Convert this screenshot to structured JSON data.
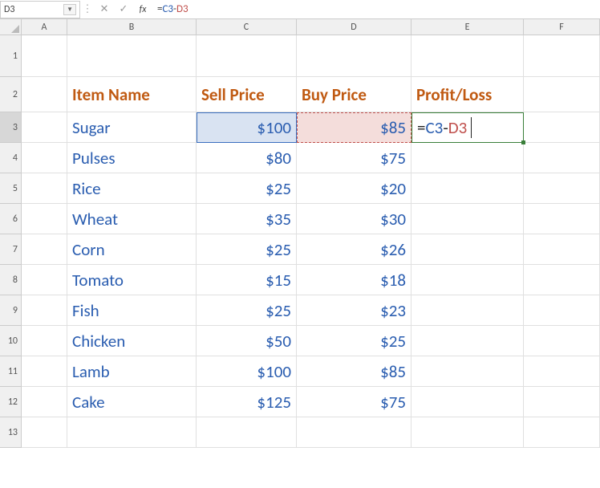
{
  "nameBox": {
    "value": "D3"
  },
  "formulaBar": {
    "cancel": "✕",
    "confirm": "✓",
    "fx": "fx",
    "prefix": "=",
    "ref1": "C3",
    "op": "-",
    "ref2": "D3"
  },
  "columns": [
    "A",
    "B",
    "C",
    "D",
    "E",
    "F"
  ],
  "rows": [
    "1",
    "2",
    "3",
    "4",
    "5",
    "6",
    "7",
    "8",
    "9",
    "10",
    "11",
    "12",
    "13"
  ],
  "headers": {
    "b": "Item Name",
    "c": "Sell Price",
    "d": "Buy Price",
    "e": "Profit/Loss"
  },
  "data": [
    {
      "item": "Sugar",
      "sell": "$100",
      "buy": "$85"
    },
    {
      "item": "Pulses",
      "sell": "$80",
      "buy": "$75"
    },
    {
      "item": "Rice",
      "sell": "$25",
      "buy": "$20"
    },
    {
      "item": "Wheat",
      "sell": "$35",
      "buy": "$30"
    },
    {
      "item": "Corn",
      "sell": "$25",
      "buy": "$26"
    },
    {
      "item": "Tomato",
      "sell": "$15",
      "buy": "$18"
    },
    {
      "item": "Fish",
      "sell": "$25",
      "buy": "$23"
    },
    {
      "item": "Chicken",
      "sell": "$50",
      "buy": "$25"
    },
    {
      "item": "Lamb",
      "sell": "$100",
      "buy": "$85"
    },
    {
      "item": "Cake",
      "sell": "$125",
      "buy": "$75"
    }
  ],
  "editingCell": {
    "prefix": "=",
    "ref1": "C3",
    "op": "-",
    "ref2": "D3"
  }
}
